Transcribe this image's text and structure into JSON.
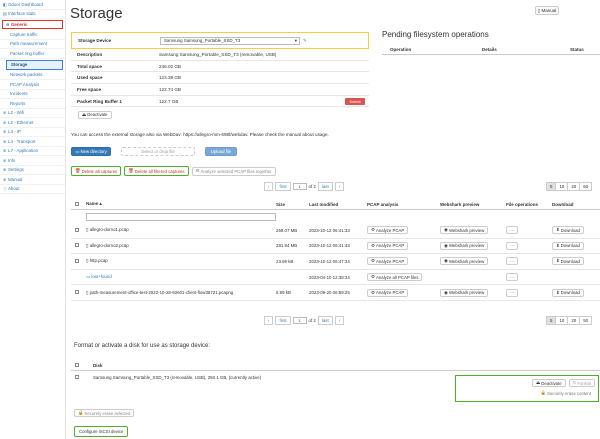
{
  "sidebar": {
    "items": [
      {
        "label": "Odoor Dashboard",
        "icon": "dashboard-icon"
      },
      {
        "label": "Interface stats",
        "icon": "none"
      },
      {
        "label": "Generic",
        "icon": "chevron-down-icon"
      },
      {
        "label": "Capture traffic"
      },
      {
        "label": "Path measurement"
      },
      {
        "label": "Packet ring buffer"
      },
      {
        "label": "Storage"
      },
      {
        "label": "Network packets"
      },
      {
        "label": "PCAP Analysis"
      },
      {
        "label": "Incidents"
      },
      {
        "label": "Reports"
      },
      {
        "label": "L2 - Wifi",
        "icon": "chevron-right-icon"
      },
      {
        "label": "L2 - Ethernet",
        "icon": "chevron-right-icon"
      },
      {
        "label": "L3 - IP",
        "icon": "chevron-right-icon"
      },
      {
        "label": "L4 - Transport",
        "icon": "chevron-right-icon"
      },
      {
        "label": "L7 - Application",
        "icon": "chevron-right-icon"
      },
      {
        "label": "Info",
        "icon": "chevron-right-icon"
      },
      {
        "label": "Settings",
        "icon": "chevron-right-icon"
      },
      {
        "label": "Manual",
        "icon": "chevron-right-icon"
      },
      {
        "label": "About",
        "icon": "info-icon"
      }
    ]
  },
  "page": {
    "title": "Storage",
    "manual_label": "Manual"
  },
  "storage_info": {
    "device_label": "Storage Device",
    "device_value": "Samsung Samsung_Portable_SSD_T3",
    "rows": [
      {
        "k": "Description",
        "v": "Samsung Samsung_Portable_SSD_T3 (removable, USB)"
      },
      {
        "k": "Total space",
        "v": "246.02 GB"
      },
      {
        "k": "Used space",
        "v": "123.39 GB"
      },
      {
        "k": "Free space",
        "v": "122.74 GB"
      },
      {
        "k": "Packet Ring Buffer 1",
        "v": "122.7 GB"
      }
    ],
    "delete_label": "Delete",
    "deactivate_label": "Deactivate"
  },
  "pending": {
    "title": "Pending filesystem operations",
    "headers": [
      "Operation",
      "Details",
      "Status"
    ]
  },
  "webdav_note": "You can access the external storage also via WebDav: https://allegro-mm-698f/webdav. Please check the manual about usage.",
  "upload": {
    "new_dir": "New directory",
    "drop_placeholder": "Select or drop file",
    "upload_label": "Upload file"
  },
  "actions": {
    "delete_all": "Delete all captures",
    "delete_filtered": "Delete all filtered captures",
    "analyze_selected": "Analyze selected PCAP files together"
  },
  "pagination": {
    "first": "first",
    "page": "1",
    "of": "of 2",
    "last": "last",
    "sizes": [
      "5",
      "10",
      "20",
      "50"
    ],
    "active_size": "5"
  },
  "files": {
    "headers": [
      "Name",
      "Size",
      "Last modified",
      "PCAP analysis",
      "Webshark preview",
      "File operations",
      "Download"
    ],
    "rows": [
      {
        "name": "allegro-dorno1.pcap",
        "size": "269.07 MB",
        "modified": "2023-10-12 06:41:33",
        "analyze": "Analyze PCAP",
        "webshark": "Webshark preview",
        "ops": "···",
        "download": "Download"
      },
      {
        "name": "allegro-dorno2.pcap",
        "size": "281.94 MB",
        "modified": "2023-10-12 06:41:43",
        "analyze": "Analyze PCAP",
        "webshark": "Webshark preview",
        "ops": "···",
        "download": "Download"
      },
      {
        "name": "http.pcap",
        "size": "23.69 kB",
        "modified": "2023-10-12 06:47:34",
        "analyze": "Analyze PCAP",
        "webshark": "Webshark preview",
        "ops": "···",
        "download": "Download"
      },
      {
        "name": "lost+found",
        "size": "",
        "modified": "2023-04-10 12:38:34",
        "analyze": "Analyze all PCAP files",
        "webshark": "",
        "ops": "···",
        "download": ""
      },
      {
        "name": "path-measurement-office-test-2022-10-28-92601-client-flow36721.pcapng",
        "size": "6.99 kB",
        "modified": "2023-09-20 06:59:25",
        "analyze": "Analyze PCAP",
        "webshark": "Webshark preview",
        "ops": "···",
        "download": "Download"
      }
    ]
  },
  "format_section": {
    "title": "Format or activate a disk for use as storage device:",
    "disk_header": "Disk",
    "disk_row": "Samsung Samsung_Portable_SSD_T3 (removable, USB), 250.1 GB, (currently active)",
    "deactivate": "Deactivate",
    "format": "Format",
    "secure_erase_content": "Securely erase content",
    "secure_erase_selected": "Securely erase selected",
    "configure_iscsi": "Configure iSCSI device"
  },
  "colors": {
    "accent": "#337ab7",
    "danger": "#d9534f",
    "highlight_green": "#4caf28",
    "highlight_yellow": "#f0d040"
  }
}
